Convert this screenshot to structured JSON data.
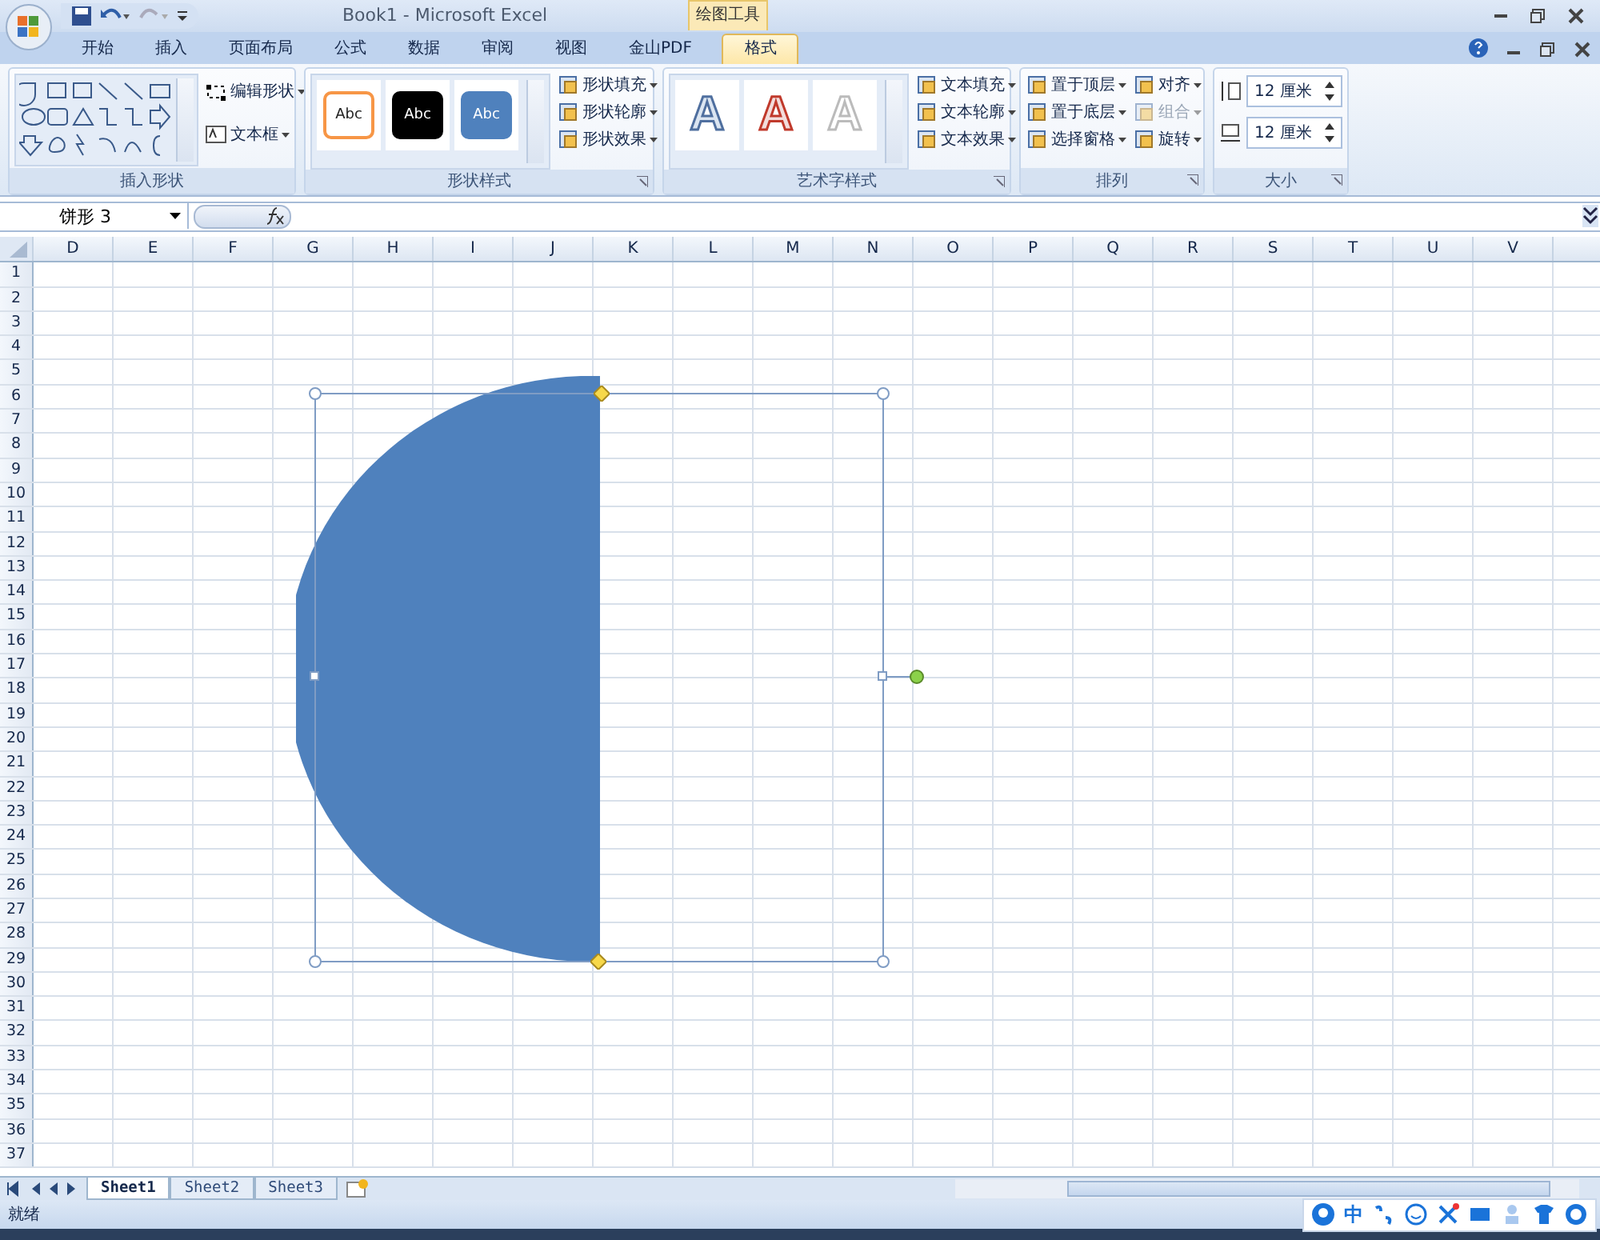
{
  "window": {
    "title": "Book1 - Microsoft Excel",
    "context_tab": "绘图工具"
  },
  "tabs": [
    {
      "label": "开始",
      "selected": false
    },
    {
      "label": "插入",
      "selected": false
    },
    {
      "label": "页面布局",
      "selected": false
    },
    {
      "label": "公式",
      "selected": false
    },
    {
      "label": "数据",
      "selected": false
    },
    {
      "label": "审阅",
      "selected": false
    },
    {
      "label": "视图",
      "selected": false
    },
    {
      "label": "金山PDF",
      "selected": false
    },
    {
      "label": "格式",
      "selected": true
    }
  ],
  "ribbon": [
    {
      "kind": "shapes",
      "label": "插入形状",
      "buttons": [
        {
          "label": "编辑形状",
          "disabled": false
        },
        {
          "label": "文本框",
          "disabled": false
        }
      ]
    },
    {
      "kind": "styles",
      "label": "形状样式",
      "swatches": [
        {
          "text": "Abc",
          "color": "#ffffff"
        },
        {
          "text": "Abc",
          "color": "#000000"
        },
        {
          "text": "Abc",
          "color": "#4f81bd"
        }
      ],
      "buttons": [
        {
          "label": "形状填充",
          "disabled": false
        },
        {
          "label": "形状轮廓",
          "disabled": false
        },
        {
          "label": "形状效果",
          "disabled": false
        }
      ]
    },
    {
      "kind": "styles",
      "label": "艺术字样式",
      "swatches": [
        {
          "text": "A",
          "color": "#dbe5f1"
        },
        {
          "text": "A",
          "color": "#f2dcdb"
        },
        {
          "text": "A",
          "color": "#ffffff"
        }
      ],
      "buttons": [
        {
          "label": "文本填充",
          "disabled": false
        },
        {
          "label": "文本轮廓",
          "disabled": false
        },
        {
          "label": "文本效果",
          "disabled": false
        }
      ]
    },
    {
      "kind": "arrange",
      "label": "排列",
      "buttons": [
        {
          "label": "置于顶层",
          "disabled": false
        },
        {
          "label": "置于底层",
          "disabled": false
        },
        {
          "label": "选择窗格",
          "disabled": false
        },
        {
          "label": "对齐",
          "disabled": false
        },
        {
          "label": "组合",
          "disabled": true
        },
        {
          "label": "旋转",
          "disabled": false
        }
      ]
    },
    {
      "kind": "size",
      "label": "大小",
      "fields": [
        {
          "value": "12 厘米"
        },
        {
          "value": "12 厘米"
        }
      ]
    }
  ],
  "formula_bar": {
    "name_box": "饼形 3"
  },
  "columns": [
    "D",
    "E",
    "F",
    "G",
    "H",
    "I",
    "J",
    "K",
    "L",
    "M",
    "N",
    "O",
    "P",
    "Q",
    "R",
    "S",
    "T",
    "U",
    "V"
  ],
  "rows": [
    "1",
    "2",
    "3",
    "4",
    "5",
    "6",
    "7",
    "8",
    "9",
    "10",
    "11",
    "12",
    "13",
    "14",
    "15",
    "16",
    "17",
    "18",
    "19",
    "20",
    "21",
    "22",
    "23",
    "24",
    "25",
    "26",
    "27",
    "28",
    "29",
    "30",
    "31",
    "32",
    "33",
    "34",
    "35",
    "36",
    "37"
  ],
  "sheets": [
    {
      "label": "Sheet1",
      "selected": true
    },
    {
      "label": "Sheet2",
      "selected": false
    },
    {
      "label": "Sheet3",
      "selected": false
    }
  ],
  "status_bar": {
    "text": "就绪",
    "ime": "中"
  }
}
